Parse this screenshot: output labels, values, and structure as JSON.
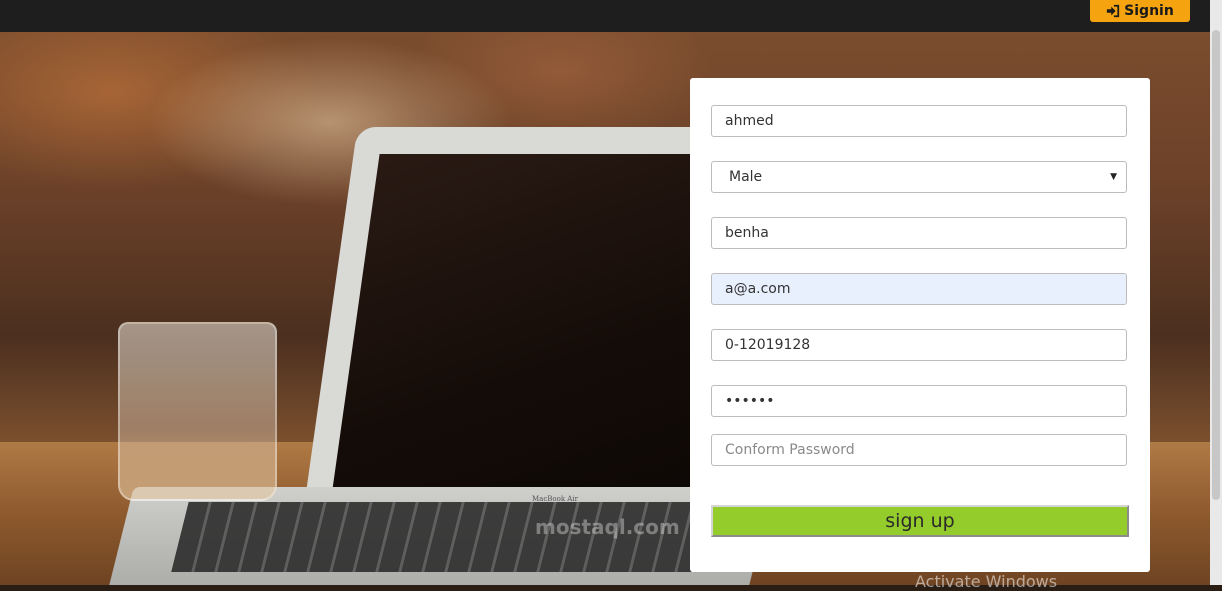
{
  "header": {
    "signin_label": "Signin",
    "signin_icon": "sign-in-icon",
    "signin_color": "#f5a410"
  },
  "background": {
    "device_brand": "MacBook Air",
    "watermark": "mostaql.com",
    "os_notice": "Activate Windows"
  },
  "form": {
    "name": {
      "value": "ahmed"
    },
    "gender": {
      "selected": "Male"
    },
    "city": {
      "value": "benha"
    },
    "email": {
      "value": "a@a.com"
    },
    "phone": {
      "value": "0-12019128"
    },
    "password": {
      "value": "••••••"
    },
    "confirm_password": {
      "value": "",
      "placeholder": "Conform Password"
    },
    "submit_label": "sign up",
    "submit_color": "#94cc2c"
  }
}
